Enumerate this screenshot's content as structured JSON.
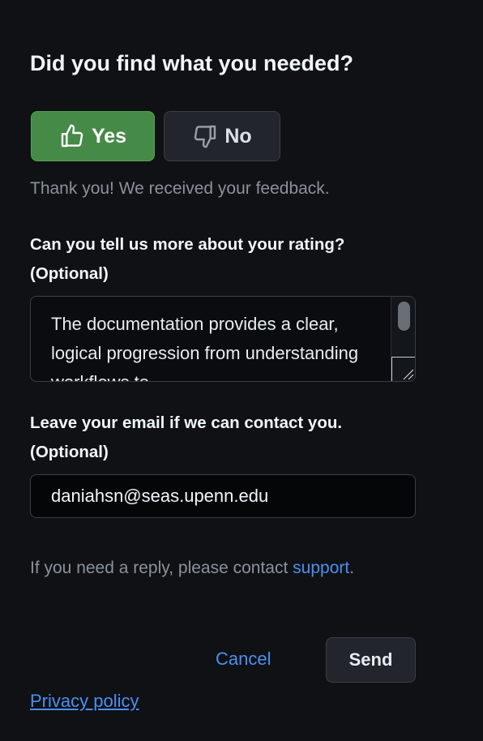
{
  "title": "Did you find what you needed?",
  "buttons": {
    "yes": "Yes",
    "no": "No",
    "cancel": "Cancel",
    "send": "Send"
  },
  "thanks": "Thank you! We received your feedback.",
  "rating_label": "Can you tell us more about your rating? (Optional)",
  "rating_text": "The documentation provides a clear, logical progression from understanding workflows to",
  "email_label": "Leave your email if we can contact you. (Optional)",
  "email_value": "daniahsn@seas.upenn.edu",
  "reply_text": "If you need a reply, please contact",
  "support_link": "support",
  "reply_end": ".",
  "privacy": "Privacy policy",
  "colors": {
    "yes_bg": "#468a47",
    "link": "#4d8ff0",
    "bg": "#0f1115"
  }
}
